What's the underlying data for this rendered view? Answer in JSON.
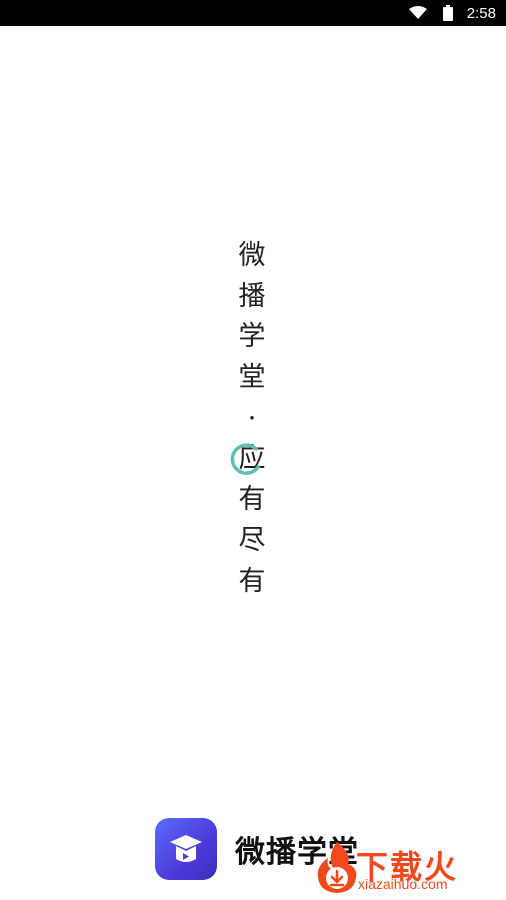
{
  "status_bar": {
    "time": "2:58",
    "icons": [
      "wifi-icon",
      "battery-icon"
    ]
  },
  "slogan": {
    "chars": [
      "微",
      "播",
      "学",
      "堂",
      "·",
      "应",
      "有",
      "尽",
      "有"
    ]
  },
  "loading": {
    "icon": "loading-spinner-icon",
    "color": "#5fbfb3"
  },
  "brand": {
    "logo_icon": "graduation-cap-play-icon",
    "name": "微播学堂",
    "logo_color": "#4b3bd8"
  },
  "watermark": {
    "logo_icon": "flame-download-icon",
    "text": "下载火",
    "url": "xiazaihuo.com",
    "color": "#f04a1c"
  }
}
